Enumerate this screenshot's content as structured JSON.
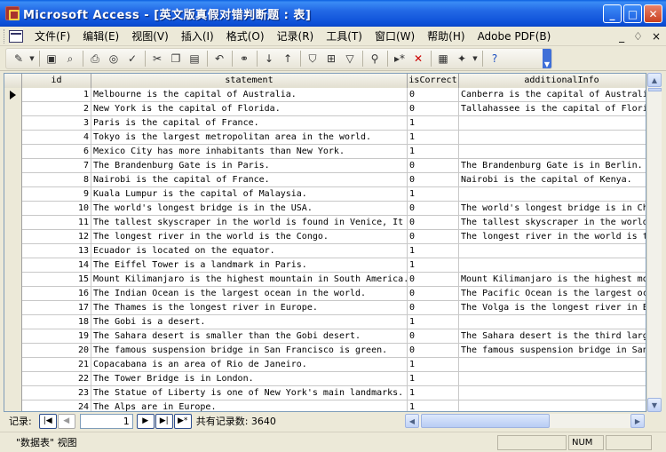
{
  "window": {
    "title": "Microsoft Access - [英文版真假对错判断题 : 表]",
    "minimize": "_",
    "maximize": "□",
    "close": "✕"
  },
  "menu": {
    "items": [
      "文件(F)",
      "编辑(E)",
      "视图(V)",
      "插入(I)",
      "格式(O)",
      "记录(R)",
      "工具(T)",
      "窗口(W)",
      "帮助(H)",
      "Adobe PDF(B)"
    ],
    "right_controls": [
      "_",
      "♢",
      "×"
    ]
  },
  "toolbar": {
    "icons": [
      "view-icon",
      "save-icon",
      "search-icon",
      "print-icon",
      "print-preview-icon",
      "spelling-icon",
      "cut-icon",
      "copy-icon",
      "paste-icon",
      "undo-icon",
      "hyperlink-icon",
      "sort-ascending-icon",
      "sort-descending-icon",
      "filter-by-selection-icon",
      "filter-by-form-icon",
      "apply-filter-icon",
      "find-icon",
      "new-record-icon",
      "delete-record-icon",
      "database-window-icon",
      "new-object-icon",
      "help-icon"
    ]
  },
  "table": {
    "columns": [
      "id",
      "statement",
      "isCorrect",
      "additionalInfo"
    ],
    "rows": [
      {
        "id": "1",
        "statement": "Melbourne is the capital of Australia.",
        "isCorrect": "0",
        "additionalInfo": "Canberra is the capital of Australia."
      },
      {
        "id": "2",
        "statement": "New York is the capital of Florida.",
        "isCorrect": "0",
        "additionalInfo": "Tallahassee is the capital of Florida."
      },
      {
        "id": "3",
        "statement": "Paris is the capital of France.",
        "isCorrect": "1",
        "additionalInfo": ""
      },
      {
        "id": "4",
        "statement": "Tokyo is the largest metropolitan area in the world.",
        "isCorrect": "1",
        "additionalInfo": ""
      },
      {
        "id": "6",
        "statement": "Mexico City has more inhabitants than New York.",
        "isCorrect": "1",
        "additionalInfo": ""
      },
      {
        "id": "7",
        "statement": "The Brandenburg Gate is in Paris.",
        "isCorrect": "0",
        "additionalInfo": "The Brandenburg Gate is in Berlin."
      },
      {
        "id": "8",
        "statement": "Nairobi is the capital of France.",
        "isCorrect": "0",
        "additionalInfo": "Nairobi is the capital of Kenya."
      },
      {
        "id": "9",
        "statement": "Kuala Lumpur is the capital of Malaysia.",
        "isCorrect": "1",
        "additionalInfo": ""
      },
      {
        "id": "10",
        "statement": "The world's longest bridge is in the USA.",
        "isCorrect": "0",
        "additionalInfo": "The world's longest bridge is in China"
      },
      {
        "id": "11",
        "statement": "The tallest skyscraper in the world is found in Venice, It",
        "isCorrect": "0",
        "additionalInfo": "The tallest skyscraper in the world is"
      },
      {
        "id": "12",
        "statement": "The longest river in the world is the Congo.",
        "isCorrect": "0",
        "additionalInfo": "The longest river in the world is the"
      },
      {
        "id": "13",
        "statement": "Ecuador is located on the equator.",
        "isCorrect": "1",
        "additionalInfo": ""
      },
      {
        "id": "14",
        "statement": "The Eiffel Tower is a landmark in Paris.",
        "isCorrect": "1",
        "additionalInfo": ""
      },
      {
        "id": "15",
        "statement": "Mount Kilimanjaro is the highest mountain in South America.",
        "isCorrect": "0",
        "additionalInfo": "Mount Kilimanjaro is the highest mount"
      },
      {
        "id": "16",
        "statement": "The Indian Ocean is the largest ocean in the world.",
        "isCorrect": "0",
        "additionalInfo": "The Pacific Ocean is the largest ocean"
      },
      {
        "id": "17",
        "statement": "The Thames is the longest river in Europe.",
        "isCorrect": "0",
        "additionalInfo": "The Volga is the longest river in Euro"
      },
      {
        "id": "18",
        "statement": "The Gobi is a desert.",
        "isCorrect": "1",
        "additionalInfo": ""
      },
      {
        "id": "19",
        "statement": "The Sahara desert is smaller than the Gobi desert.",
        "isCorrect": "0",
        "additionalInfo": "The Sahara desert is the third largest"
      },
      {
        "id": "20",
        "statement": "The famous suspension bridge in San Francisco is green.",
        "isCorrect": "0",
        "additionalInfo": "The famous suspension bridge in San Fr"
      },
      {
        "id": "21",
        "statement": "Copacabana is an area of Rio de Janeiro.",
        "isCorrect": "1",
        "additionalInfo": ""
      },
      {
        "id": "22",
        "statement": "The Tower Bridge is in London.",
        "isCorrect": "1",
        "additionalInfo": ""
      },
      {
        "id": "23",
        "statement": "The Statue of Liberty is one of New York's main landmarks.",
        "isCorrect": "1",
        "additionalInfo": ""
      },
      {
        "id": "24",
        "statement": "The Alps are in Europe.",
        "isCorrect": "1",
        "additionalInfo": ""
      }
    ]
  },
  "navigation": {
    "label": "记录:",
    "first": "|◀",
    "prev": "◀",
    "current": "1",
    "next": "▶",
    "last": "▶|",
    "new": "▶*",
    "count_text": "共有记录数: 3640"
  },
  "status": {
    "view_text": "\"数据表\" 视图",
    "num": "NUM"
  },
  "colors": {
    "titlebar": "#0b4ed6",
    "chrome": "#ece9d8"
  }
}
